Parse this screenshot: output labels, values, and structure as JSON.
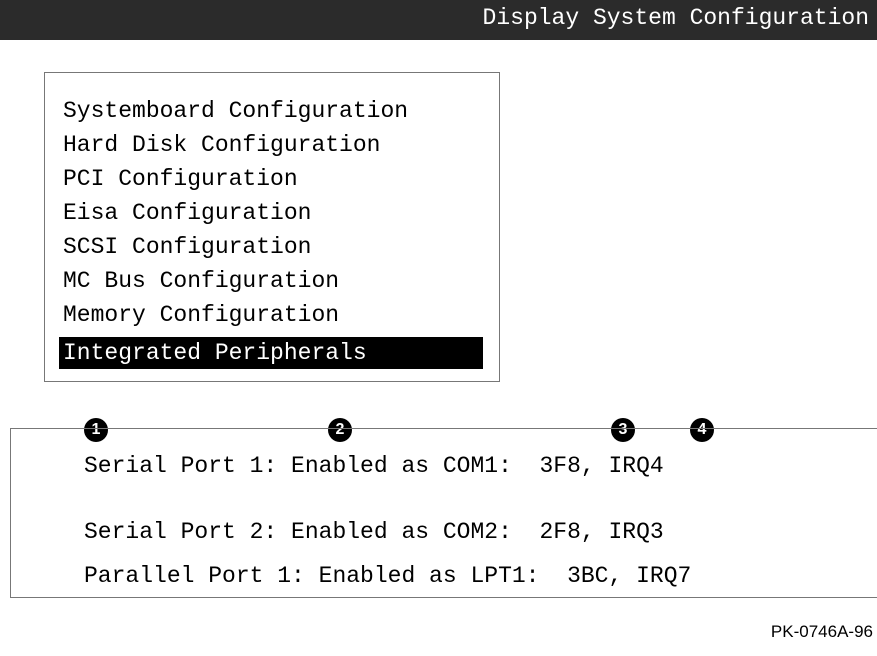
{
  "header": {
    "title": "Display System Configuration"
  },
  "menu": {
    "items": [
      {
        "label": "Systemboard Configuration"
      },
      {
        "label": "Hard Disk Configuration"
      },
      {
        "label": "PCI Configuration"
      },
      {
        "label": "Eisa Configuration"
      },
      {
        "label": "SCSI Configuration"
      },
      {
        "label": "MC Bus Configuration"
      },
      {
        "label": "Memory Configuration"
      },
      {
        "label": "Integrated Peripherals"
      }
    ],
    "selected": "Integrated Peripherals"
  },
  "callouts": [
    "1",
    "2",
    "3",
    "4"
  ],
  "details": {
    "lines": [
      "Serial Port 1: Enabled as COM1:  3F8, IRQ4",
      "Serial Port 2: Enabled as COM2:  2F8, IRQ3",
      "Parallel Port 1: Enabled as LPT1:  3BC, IRQ7"
    ]
  },
  "figure_id": "PK-0746A-96",
  "colors": {
    "titlebar_bg": "#2b2b2b",
    "selected_bg": "#000000",
    "selected_fg": "#ffffff"
  }
}
